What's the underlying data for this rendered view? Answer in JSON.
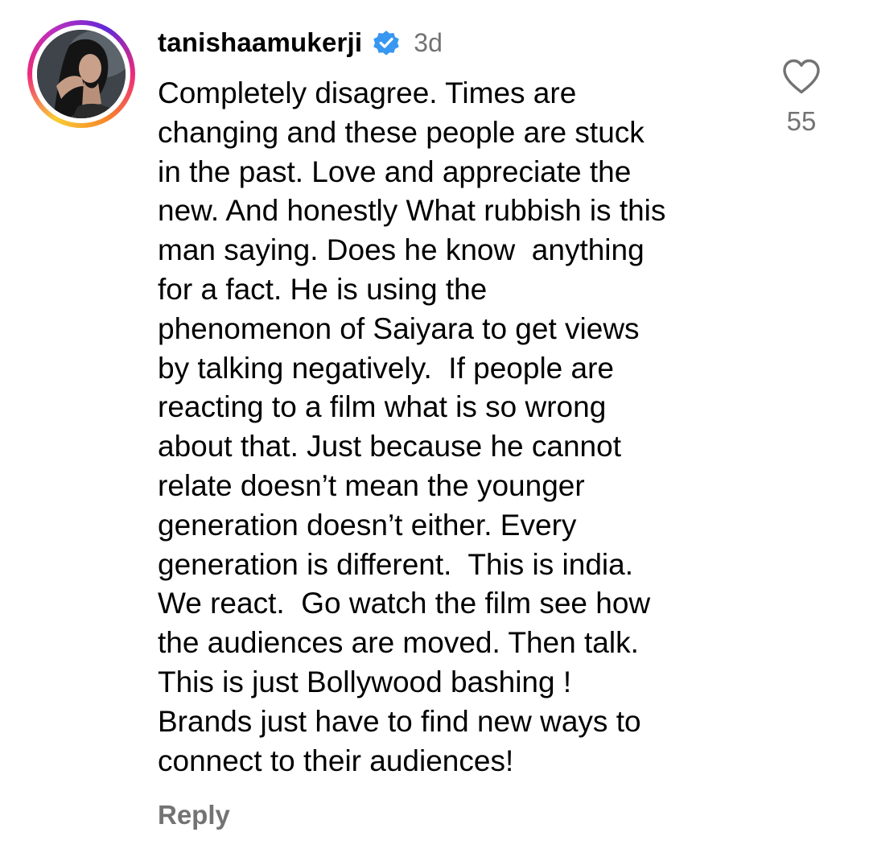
{
  "comment": {
    "username": "tanishaamukerji",
    "verified_icon": "verified-badge-icon",
    "timestamp": "3d",
    "body_lines": [
      "Completely disagree. Times are",
      "changing and these people are stuck",
      "in the past. Love and appreciate the",
      "new. And honestly What rubbish is this",
      "man saying. Does he know  anything",
      "for a fact. He is using the",
      "phenomenon of Saiyara to get views",
      "by talking negatively.  If people are",
      "reacting to a film what is so wrong",
      "about that. Just because he cannot",
      "relate doesn’t mean the younger",
      "generation doesn’t either. Every",
      "generation is different.  This is india.",
      "We react.  Go watch the film see how",
      "the audiences are moved. Then talk.",
      "This is just Bollywood bashing !",
      "Brands just have to find new ways to",
      "connect to their audiences!"
    ],
    "reply_label": "Reply",
    "like_icon": "heart-outline-icon",
    "like_count": "55"
  },
  "colors": {
    "text_primary": "#000000",
    "text_secondary": "#737373",
    "verified_blue": "#3897f0",
    "story_ring_gradient": [
      "#f9ce34",
      "#ee2a7b",
      "#6228d7"
    ]
  }
}
